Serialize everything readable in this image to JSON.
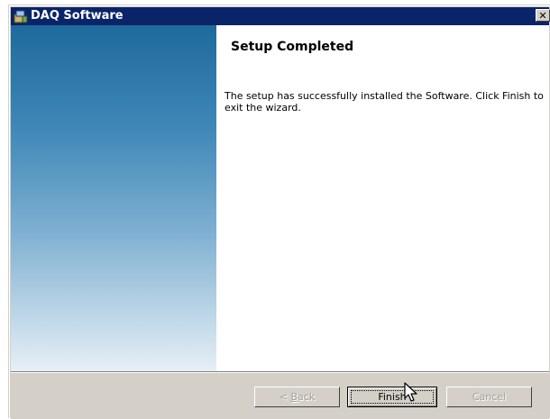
{
  "window": {
    "title": "DAQ Software",
    "close_glyph": "✕",
    "icon": "installer-icon"
  },
  "page": {
    "heading": "Setup Completed",
    "message": "The setup has successfully installed the Software. Click Finish to exit the wizard."
  },
  "buttons": {
    "back": {
      "pre": "< ",
      "accel": "B",
      "post": "ack",
      "enabled": false
    },
    "finish": {
      "label": "Finish",
      "enabled": true
    },
    "cancel": {
      "label": "Cancel",
      "enabled": false
    }
  },
  "colors": {
    "titlebar": "#0a246a",
    "face": "#d4d0c8",
    "banner_top": "#1e6a9c",
    "banner_bottom": "#e6eff6"
  }
}
